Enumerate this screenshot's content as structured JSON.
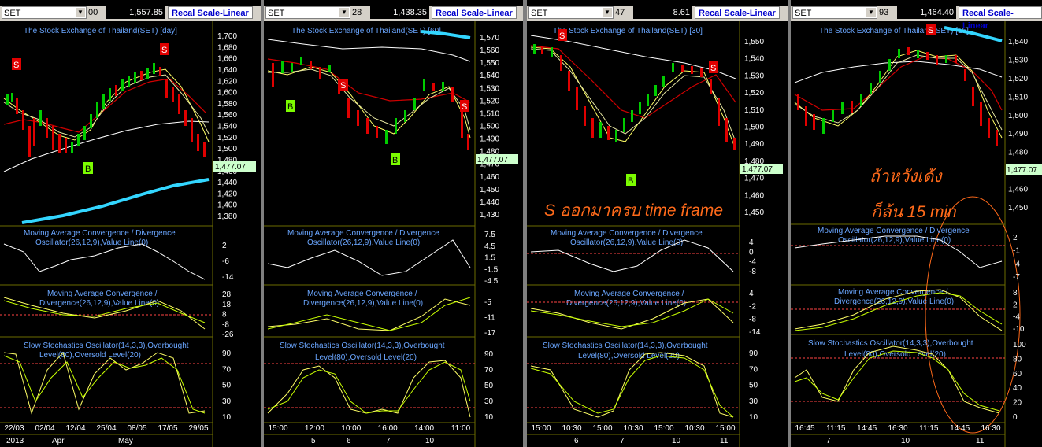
{
  "panels": [
    {
      "symbol": "SET",
      "price_frag": "00",
      "price": "1,557.85",
      "recal": "Recal Scale-Linear",
      "title": "The Stock Exchange of Thailand(SET) [day]",
      "last_price": "1,477.07",
      "price_ticks": [
        "1,700",
        "1,680",
        "1,660",
        "1,640",
        "1,620",
        "1,600",
        "1,580",
        "1,560",
        "1,540",
        "1,520",
        "1,500",
        "1,480",
        "1,460",
        "1,440",
        "1,420",
        "1,400",
        "1,380"
      ],
      "macd1_title": [
        "Moving Average Convergence / Divergence",
        "Oscillator(26,12,9),Value Line(0)"
      ],
      "macd1_ticks": [
        "2",
        "-6",
        "-14"
      ],
      "macd2_title": [
        "Moving Average Convergence /",
        "Divergence(26,12,9),Value Line(0)"
      ],
      "macd2_ticks": [
        "28",
        "18",
        "8",
        "-8",
        "-26"
      ],
      "stoch_title": [
        "Slow Stochastics Oscillator(14,3,3),Overbought",
        "Level(80),Oversold Level(20)"
      ],
      "stoch_ticks": [
        "90",
        "70",
        "50",
        "30",
        "10"
      ],
      "date_ticks": [
        "22/03",
        "02/04",
        "12/04",
        "25/04",
        "08/05",
        "17/05",
        "29/05"
      ],
      "bottom_ticks": [
        "2013",
        "Apr",
        "May"
      ],
      "signals": [
        "S",
        "S",
        "B",
        "B"
      ]
    },
    {
      "symbol": "SET",
      "price_frag": "28",
      "price": "1,438.35",
      "recal": "Recal Scale-Linear",
      "title": "The Stock Exchange of Thailand(SET) [60]",
      "last_price": "1,477.07",
      "price_ticks": [
        "1,570",
        "1,560",
        "1,550",
        "1,540",
        "1,530",
        "1,520",
        "1,510",
        "1,500",
        "1,490",
        "1,480",
        "1,470",
        "1,460",
        "1,450",
        "1,440",
        "1,430"
      ],
      "macd1_title": [
        "Moving Average Convergence / Divergence",
        "Oscillator(26,12,9),Value Line(0)"
      ],
      "macd1_ticks": [
        "7.5",
        "4.5",
        "1.5",
        "-1.5",
        "-4.5"
      ],
      "macd2_title": [
        "Moving Average Convergence /",
        "Divergence(26,12,9),Value Line(0)"
      ],
      "macd2_ticks": [
        "-5",
        "-11",
        "-17"
      ],
      "stoch_title": [
        "Slow Stochastics Oscillator(14,3,3),Overbought",
        "Level(80),Oversold Level(20)"
      ],
      "stoch_ticks": [
        "90",
        "70",
        "50",
        "30",
        "10"
      ],
      "date_ticks": [
        "15:00",
        "12:00",
        "10:00",
        "16:00",
        "14:00",
        "11:00"
      ],
      "bottom_ticks": [
        "5",
        "6",
        "7",
        "10"
      ],
      "signals": [
        "S",
        "S",
        "B",
        "B"
      ]
    },
    {
      "symbol": "SET",
      "price_frag": "47",
      "price": "8.61",
      "recal": "Recal Scale-Linear",
      "title": "The Stock Exchange of Thailand(SET) [30]",
      "last_price": "1,477.07",
      "price_ticks": [
        "1,550",
        "1,540",
        "1,530",
        "1,520",
        "1,510",
        "1,500",
        "1,490",
        "1,480",
        "1,470",
        "1,460",
        "1,450"
      ],
      "macd1_title": [
        "Moving Average Convergence / Divergence",
        "Oscillator(26,12,9),Value Line(0)"
      ],
      "macd1_ticks": [
        "4",
        "0",
        "-4",
        "-8"
      ],
      "macd2_title": [
        "Moving Average Convergence /",
        "Divergence(26,12,9),Value Line(0)"
      ],
      "macd2_ticks": [
        "4",
        "-2",
        "-8",
        "-14"
      ],
      "stoch_title": [
        "Slow Stochastics Oscillator(14,3,3),Overbought",
        "Level(80),Oversold Level(20)"
      ],
      "stoch_ticks": [
        "90",
        "70",
        "50",
        "30",
        "10"
      ],
      "date_ticks": [
        "15:00",
        "10:30",
        "15:00",
        "10:30",
        "15:00",
        "10:30",
        "15:00"
      ],
      "bottom_ticks": [
        "6",
        "7",
        "10",
        "11"
      ],
      "signals": [
        "S",
        "S",
        "B"
      ],
      "annotation": "S ออกมาครบ time frame"
    },
    {
      "symbol": "SET",
      "price_frag": "93",
      "price": "1,464.40",
      "recal": "Recal Scale-Linear",
      "title": "The Stock Exchange of Thailand(SET) [15]",
      "last_price": "1,477.07",
      "price_ticks": [
        "1,540",
        "1,530",
        "1,520",
        "1,510",
        "1,500",
        "1,490",
        "1,480",
        "1,470",
        "1,460",
        "1,450"
      ],
      "macd1_title": [
        "Moving Average Convergence / Divergence",
        "Oscillator(26,12,9),Value Line(0)"
      ],
      "macd1_ticks": [
        "2",
        "-1",
        "-4",
        "-7"
      ],
      "macd2_title": [
        "Moving Average Convergence /",
        "Divergence(26,12,9),Value Line(0)"
      ],
      "macd2_ticks": [
        "8",
        "2",
        "-4",
        "-10"
      ],
      "stoch_title": [
        "Slow Stochastics Oscillator(14,3,3),Overbought",
        "Level(80),Oversold Level(20)"
      ],
      "stoch_ticks": [
        "100",
        "80",
        "60",
        "40",
        "20",
        "0"
      ],
      "date_ticks": [
        "16:45",
        "11:15",
        "14:45",
        "16:30",
        "11:15",
        "14:45",
        "16:30"
      ],
      "bottom_ticks": [
        "7",
        "10",
        "11"
      ],
      "signals": [
        "S"
      ],
      "annotation_line1": "ถ้าหวังเด้ง",
      "annotation_line2": "ก็ล้น 15 min"
    }
  ],
  "colors": {
    "bg": "#000000",
    "up": "#00cc00",
    "down": "#e00000",
    "ema_fast": "#ffff66",
    "ema_mid": "#e5e5a0",
    "ema_slow": "#d00000",
    "ema_long": "#ffffff",
    "ema_xlong": "#33d6ff",
    "osc": "#ffffff",
    "sig": "#c8ff00",
    "ob": "#ff4444",
    "label": "#ff6a1a",
    "buy_bg": "#7cfc00",
    "sell_bg": "#e00000"
  },
  "icons": {
    "dropdown": "chevron-down-icon"
  }
}
